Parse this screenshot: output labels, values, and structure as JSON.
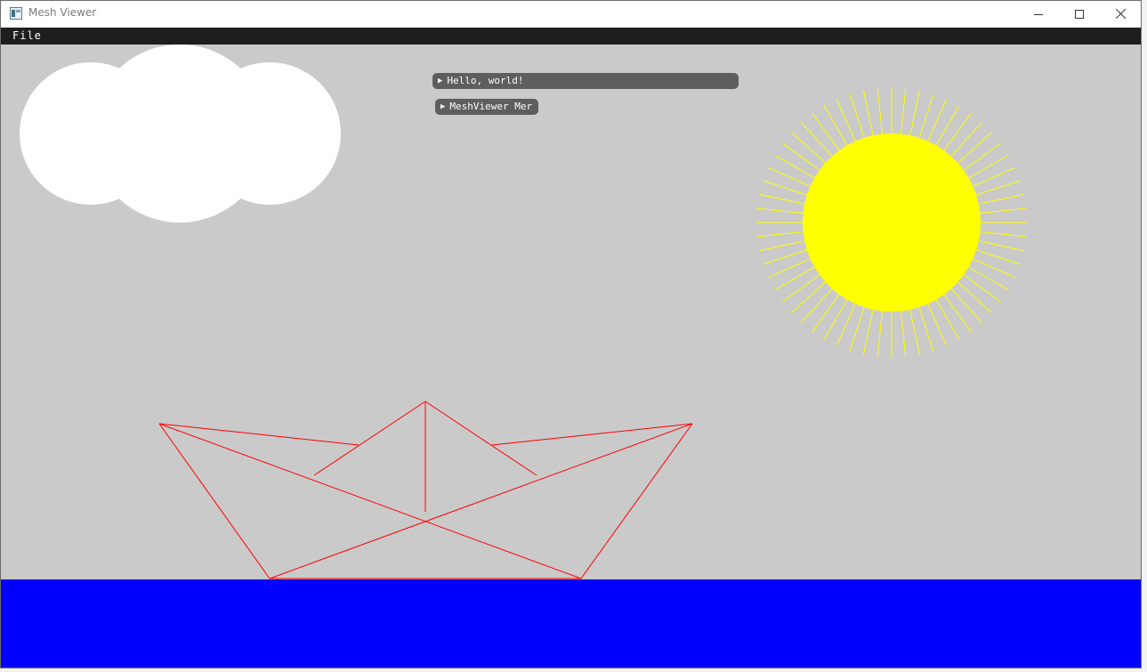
{
  "window": {
    "title": "Mesh Viewer",
    "icon": "app-window-icon"
  },
  "titlebar_buttons": {
    "minimize_icon": "minimize-icon",
    "maximize_icon": "maximize-icon",
    "close_icon": "close-icon"
  },
  "menubar": {
    "items": [
      {
        "label": "File"
      }
    ]
  },
  "overlay_windows": [
    {
      "title": "Hello, world!",
      "state": "collapsed"
    },
    {
      "title": "MeshViewer Mer",
      "state": "collapsed"
    }
  ],
  "scene": {
    "objects": [
      "cloud",
      "sun",
      "paper-boat",
      "water"
    ],
    "colors": {
      "background": "#cacaca",
      "cloud": "#ffffff",
      "sun": "#ffff00",
      "boat_lines": "#ff0000",
      "water": "#0000ff",
      "menubar": "#1e1e1e",
      "overlay_window": "#5e5e5e"
    }
  }
}
